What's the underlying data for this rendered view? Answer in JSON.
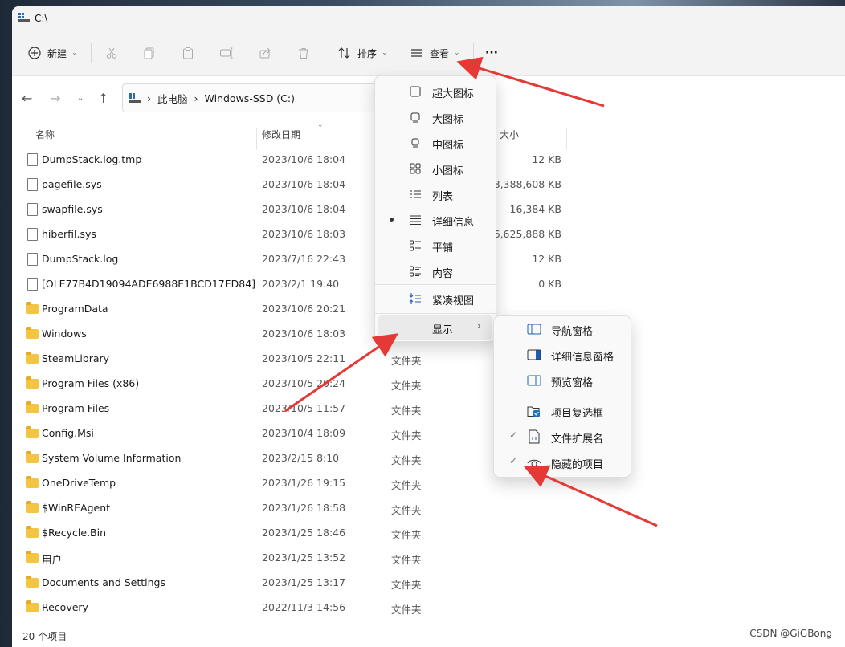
{
  "window": {
    "title": "C:\\"
  },
  "toolbar": {
    "new_label": "新建",
    "sort_label": "排序",
    "view_label": "查看",
    "more_label": "···"
  },
  "address": {
    "crumbs": [
      "此电脑",
      "Windows-SSD (C:)"
    ]
  },
  "columns": {
    "name": "名称",
    "date": "修改日期",
    "size": "大小"
  },
  "files": [
    {
      "name": "DumpStack.log.tmp",
      "date": "2023/10/6 18:04",
      "type": "",
      "size": "12 KB",
      "kind": "file"
    },
    {
      "name": "pagefile.sys",
      "date": "2023/10/6 18:04",
      "type": "",
      "size": "8,388,608 KB",
      "kind": "file"
    },
    {
      "name": "swapfile.sys",
      "date": "2023/10/6 18:04",
      "type": "",
      "size": "16,384 KB",
      "kind": "file"
    },
    {
      "name": "hiberfil.sys",
      "date": "2023/10/6 18:03",
      "type": "",
      "size": "6,625,888 KB",
      "kind": "file"
    },
    {
      "name": "DumpStack.log",
      "date": "2023/7/16 22:43",
      "type": "",
      "size": "12 KB",
      "kind": "file"
    },
    {
      "name": "[OLE77B4D19094ADE6988E1BCD17ED84]",
      "date": "2023/2/1 19:40",
      "type": "",
      "size": "0 KB",
      "kind": "file"
    },
    {
      "name": "ProgramData",
      "date": "2023/10/6 20:21",
      "type": "",
      "size": "",
      "kind": "folder"
    },
    {
      "name": "Windows",
      "date": "2023/10/6 18:03",
      "type": "",
      "size": "",
      "kind": "folder"
    },
    {
      "name": "SteamLibrary",
      "date": "2023/10/5 22:11",
      "type": "文件夹",
      "size": "",
      "kind": "folder"
    },
    {
      "name": "Program Files (x86)",
      "date": "2023/10/5 20:24",
      "type": "文件夹",
      "size": "",
      "kind": "folder"
    },
    {
      "name": "Program Files",
      "date": "2023/10/5 11:57",
      "type": "文件夹",
      "size": "",
      "kind": "folder"
    },
    {
      "name": "Config.Msi",
      "date": "2023/10/4 18:09",
      "type": "文件夹",
      "size": "",
      "kind": "folder"
    },
    {
      "name": "System Volume Information",
      "date": "2023/2/15 8:10",
      "type": "文件夹",
      "size": "",
      "kind": "folder"
    },
    {
      "name": "OneDriveTemp",
      "date": "2023/1/26 19:15",
      "type": "文件夹",
      "size": "",
      "kind": "folder"
    },
    {
      "name": "$WinREAgent",
      "date": "2023/1/26 18:58",
      "type": "文件夹",
      "size": "",
      "kind": "folder"
    },
    {
      "name": "$Recycle.Bin",
      "date": "2023/1/25 18:46",
      "type": "文件夹",
      "size": "",
      "kind": "folder"
    },
    {
      "name": "用户",
      "date": "2023/1/25 13:52",
      "type": "文件夹",
      "size": "",
      "kind": "folder"
    },
    {
      "name": "Documents and Settings",
      "date": "2023/1/25 13:17",
      "type": "文件夹",
      "size": "",
      "kind": "folder"
    },
    {
      "name": "Recovery",
      "date": "2022/11/3 14:56",
      "type": "文件夹",
      "size": "",
      "kind": "folder"
    }
  ],
  "status": {
    "count": "20 个项目"
  },
  "watermark": "CSDN @GiGBong",
  "view_menu": {
    "items": [
      {
        "label": "超大图标",
        "icon": "extra-large-icons-icon"
      },
      {
        "label": "大图标",
        "icon": "large-icons-icon"
      },
      {
        "label": "中图标",
        "icon": "medium-icons-icon"
      },
      {
        "label": "小图标",
        "icon": "small-icons-icon"
      },
      {
        "label": "列表",
        "icon": "list-icon"
      },
      {
        "label": "详细信息",
        "icon": "details-icon",
        "selected": true
      },
      {
        "label": "平铺",
        "icon": "tiles-icon"
      },
      {
        "label": "内容",
        "icon": "content-icon"
      }
    ],
    "compact_label": "紧凑视图",
    "show_label": "显示"
  },
  "show_menu": {
    "items": [
      {
        "label": "导航窗格",
        "icon": "navigation-pane-icon"
      },
      {
        "label": "详细信息窗格",
        "icon": "details-pane-icon"
      },
      {
        "label": "预览窗格",
        "icon": "preview-pane-icon"
      },
      {
        "label": "项目复选框",
        "icon": "item-checkbox-icon"
      },
      {
        "label": "文件扩展名",
        "icon": "file-extension-icon",
        "checked": true
      },
      {
        "label": "隐藏的项目",
        "icon": "hidden-items-icon",
        "checked": true
      }
    ]
  },
  "colors": {
    "accent": "#e53935",
    "folder": "#f4c542",
    "checkbox": "#1a73c9"
  }
}
